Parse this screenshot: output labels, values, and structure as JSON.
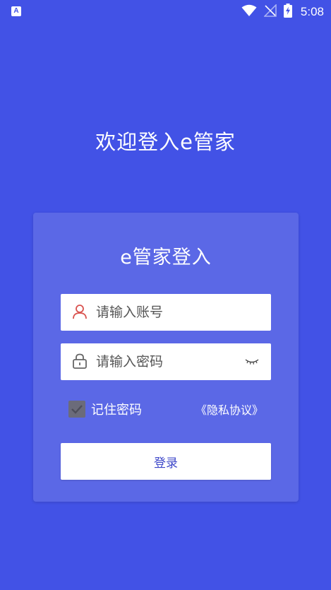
{
  "status_bar": {
    "app_icon_letter": "A",
    "time": "5:08",
    "icons": [
      "wifi-icon",
      "no-signal-icon",
      "battery-charging-icon"
    ]
  },
  "welcome": {
    "title": "欢迎登入e管家"
  },
  "login_card": {
    "title": "e管家登入",
    "account": {
      "placeholder": "请输入账号",
      "value": "",
      "icon": "user-icon"
    },
    "password": {
      "placeholder": "请输入密码",
      "value": "",
      "icon": "lock-icon",
      "toggle_icon": "eye-closed-icon"
    },
    "remember": {
      "label": "记住密码",
      "checked": true
    },
    "privacy_link": "《隐私协议》",
    "login_button": "登录"
  },
  "colors": {
    "background": "#4252e6",
    "card": "#5b68e6",
    "button_text": "#3d47c9",
    "user_icon": "#d9534f",
    "checkbox": "#6b6b7a"
  }
}
